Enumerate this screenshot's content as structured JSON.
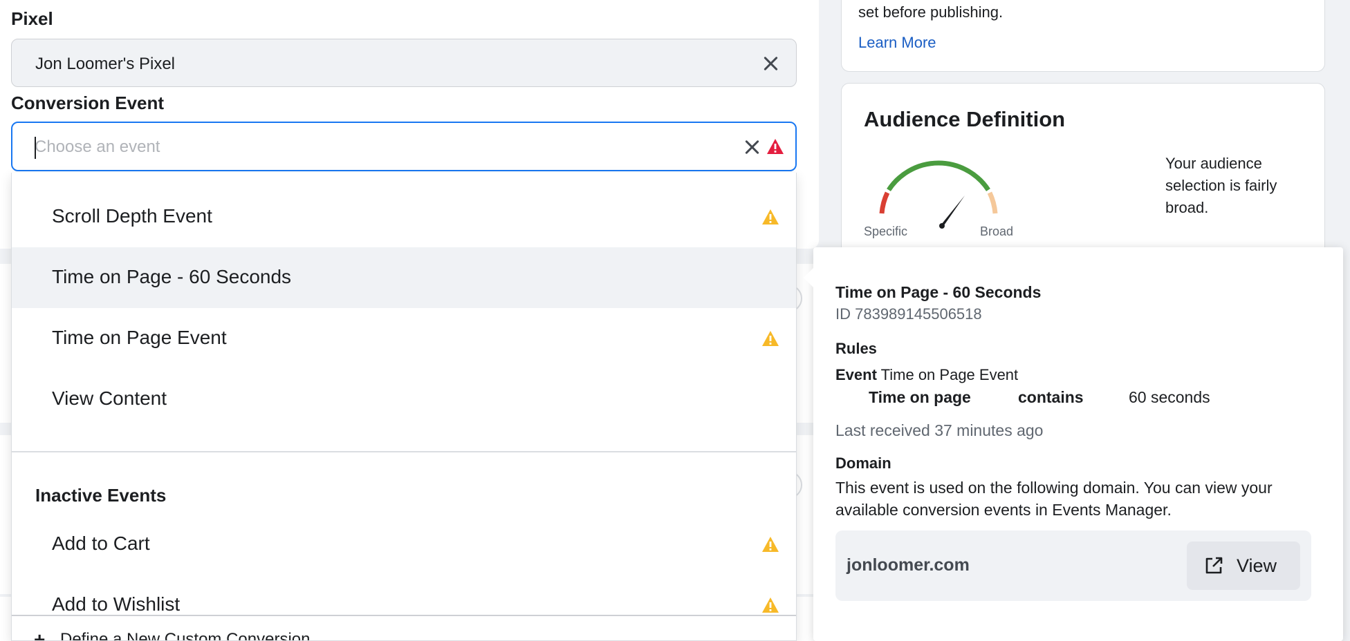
{
  "pixel": {
    "label": "Pixel",
    "value": "Jon Loomer's Pixel"
  },
  "conversion_event": {
    "label": "Conversion Event",
    "placeholder": "Choose an event"
  },
  "dropdown": {
    "active_options": [
      {
        "label": "Scroll Depth Event",
        "warning": true
      },
      {
        "label": "Time on Page - 60 Seconds",
        "warning": false,
        "highlighted": true
      },
      {
        "label": "Time on Page Event",
        "warning": true
      },
      {
        "label": "View Content",
        "warning": false
      }
    ],
    "inactive_heading": "Inactive Events",
    "inactive_options": [
      {
        "label": "Add to Cart",
        "warning": true
      },
      {
        "label": "Add to Wishlist",
        "warning": true
      }
    ],
    "footer_label": "Define a New Custom Conversion"
  },
  "right_card": {
    "text": "set before publishing.",
    "link": "Learn More"
  },
  "audience": {
    "title": "Audience Definition",
    "specific_label": "Specific",
    "broad_label": "Broad",
    "description": "Your audience selection is fairly broad.",
    "gauge_colors": {
      "low": "#d93f33",
      "mid": "#4a9c3f",
      "high": "#f5c89a"
    }
  },
  "tooltip": {
    "title": "Time on Page - 60 Seconds",
    "id": "ID 783989145506518",
    "rules_heading": "Rules",
    "event_label": "Event",
    "event_value": "Time on Page Event",
    "rule_field": "Time on page",
    "rule_operator": "contains",
    "rule_value": "60 seconds",
    "last_received": "Last received 37 minutes ago",
    "domain_heading": "Domain",
    "domain_desc": "This event is used on the following domain. You can view your available conversion events in Events Manager.",
    "domain": "jonloomer.com",
    "view_label": "View"
  },
  "colors": {
    "accent": "#1877f2",
    "warning": "#f7b928",
    "error": "#e41e3f",
    "link": "#1b5ec4"
  }
}
